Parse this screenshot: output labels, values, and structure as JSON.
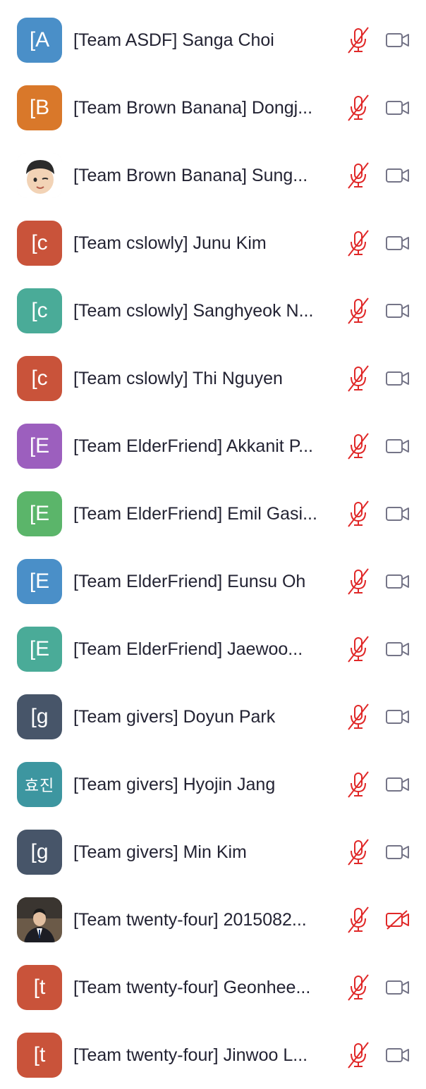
{
  "participants": [
    {
      "initials": "[A",
      "name": "[Team ASDF] Sanga Choi",
      "color": "#4a8fc8",
      "avatar_type": "initials",
      "mic": "muted",
      "video": "on"
    },
    {
      "initials": "[B",
      "name": "[Team Brown Banana] Dongj...",
      "color": "#d9782a",
      "avatar_type": "initials",
      "mic": "muted",
      "video": "on"
    },
    {
      "initials": "",
      "name": "[Team Brown Banana] Sung...",
      "color": "#f4f4f4",
      "avatar_type": "memoji",
      "mic": "muted",
      "video": "on"
    },
    {
      "initials": "[c",
      "name": "[Team cslowly] Junu Kim",
      "color": "#c9533a",
      "avatar_type": "initials",
      "mic": "muted",
      "video": "on"
    },
    {
      "initials": "[c",
      "name": "[Team cslowly] Sanghyeok N...",
      "color": "#4aab98",
      "avatar_type": "initials",
      "mic": "muted",
      "video": "on"
    },
    {
      "initials": "[c",
      "name": "[Team cslowly] Thi Nguyen",
      "color": "#c9533a",
      "avatar_type": "initials",
      "mic": "muted",
      "video": "on"
    },
    {
      "initials": "[E",
      "name": "[Team ElderFriend] Akkanit P...",
      "color": "#9c5fbe",
      "avatar_type": "initials",
      "mic": "muted",
      "video": "on"
    },
    {
      "initials": "[E",
      "name": "[Team ElderFriend] Emil Gasi...",
      "color": "#5bb56a",
      "avatar_type": "initials",
      "mic": "muted",
      "video": "on"
    },
    {
      "initials": "[E",
      "name": "[Team ElderFriend] Eunsu Oh",
      "color": "#4a8fc8",
      "avatar_type": "initials",
      "mic": "muted",
      "video": "on"
    },
    {
      "initials": "[E",
      "name": "[Team ElderFriend] Jaewoo...",
      "color": "#4aab98",
      "avatar_type": "initials",
      "mic": "muted",
      "video": "on"
    },
    {
      "initials": "[g",
      "name": "[Team givers] Doyun Park",
      "color": "#475569",
      "avatar_type": "initials",
      "mic": "muted",
      "video": "on"
    },
    {
      "initials": "효진",
      "name": "[Team givers] Hyojin Jang",
      "color": "#3d96a0",
      "avatar_type": "korean",
      "mic": "muted",
      "video": "on"
    },
    {
      "initials": "[g",
      "name": "[Team givers] Min Kim",
      "color": "#475569",
      "avatar_type": "initials",
      "mic": "muted",
      "video": "on"
    },
    {
      "initials": "",
      "name": "[Team twenty-four] 2015082...",
      "color": "#2a2a2a",
      "avatar_type": "photo",
      "mic": "muted",
      "video": "off"
    },
    {
      "initials": "[t",
      "name": "[Team twenty-four] Geonhee...",
      "color": "#c9533a",
      "avatar_type": "initials",
      "mic": "muted",
      "video": "on"
    },
    {
      "initials": "[t",
      "name": "[Team twenty-four] Jinwoo L...",
      "color": "#c9533a",
      "avatar_type": "initials",
      "mic": "muted",
      "video": "on"
    }
  ],
  "colors": {
    "muted_icon": "#e02828",
    "camera_icon": "#747487",
    "name_text": "#232333"
  }
}
